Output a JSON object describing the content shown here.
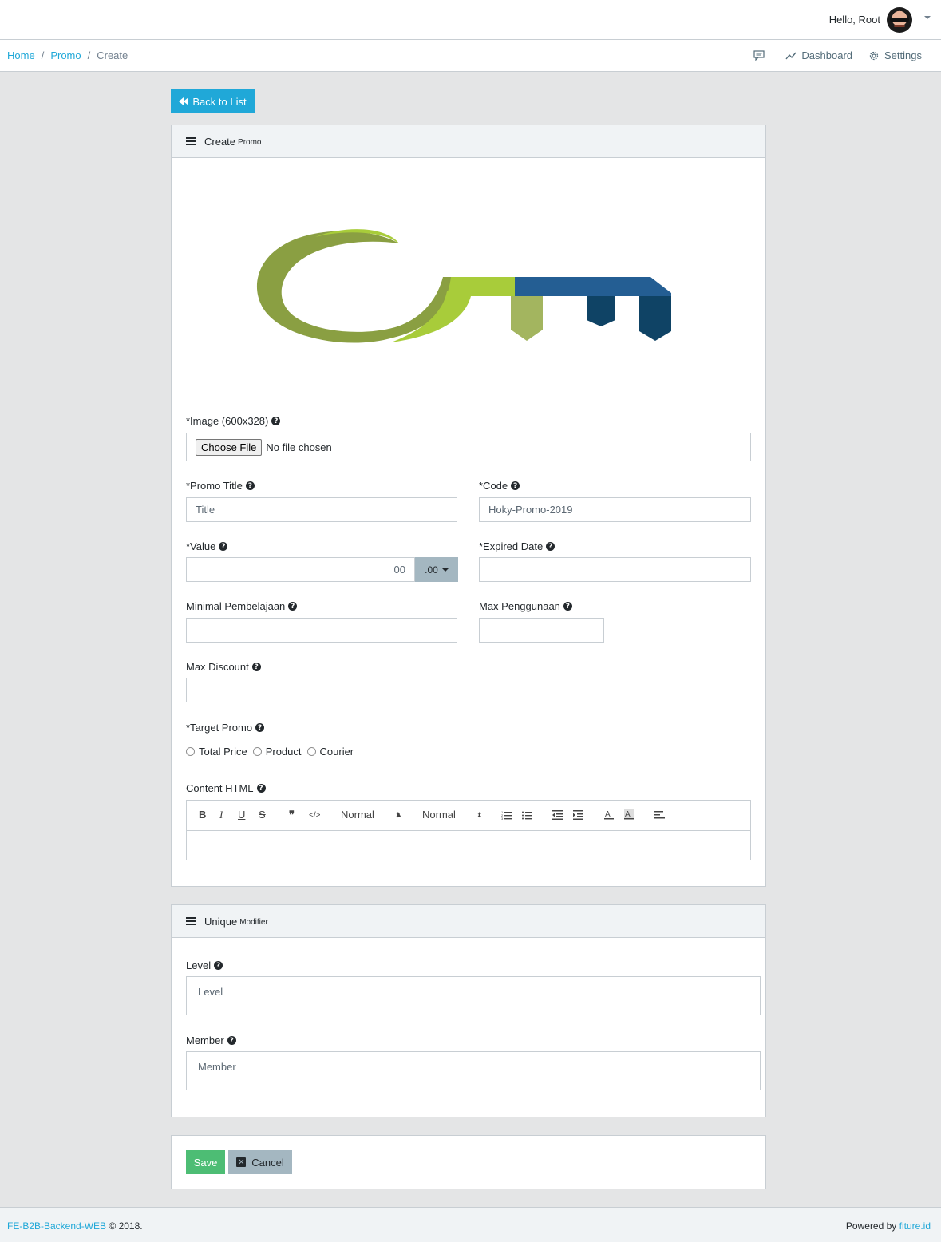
{
  "header": {
    "greeting": "Hello, Root"
  },
  "breadcrumb": {
    "items": [
      "Home",
      "Promo"
    ],
    "separator": "/",
    "active": "Create",
    "dashboard": "Dashboard",
    "settings": "Settings"
  },
  "back_button": "Back to List",
  "create_card": {
    "title": "Create",
    "subtitle": "Promo",
    "image_label": "*Image (600x328)",
    "choose_file": "Choose File",
    "no_file": "No file chosen",
    "promo_title_label": "*Promo Title",
    "promo_title_placeholder": "Title",
    "code_label": "*Code",
    "code_placeholder": "Hoky-Promo-2019",
    "value_label": "*Value",
    "value_placeholder": "00",
    "value_dropdown": ".00",
    "expired_label": "*Expired Date",
    "minimal_label": "Minimal Pembelajaan",
    "max_usage_label": "Max Penggunaan",
    "max_discount_label": "Max Discount",
    "target_label": "*Target Promo",
    "target_options": [
      "Total Price",
      "Product",
      "Courier"
    ],
    "content_label": "Content HTML",
    "editor": {
      "font_size": "Normal",
      "header": "Normal"
    }
  },
  "unique_card": {
    "title": "Unique",
    "subtitle": "Modifier",
    "level_label": "Level",
    "level_placeholder": "Level",
    "member_label": "Member",
    "member_placeholder": "Member"
  },
  "actions": {
    "save": "Save",
    "cancel": "Cancel"
  },
  "footer": {
    "app": "FE-B2B-Backend-WEB",
    "copyright": "© 2018.",
    "powered": "Powered by",
    "brand": "fiture.id"
  },
  "colors": {
    "primary": "#20a8d8",
    "success": "#4dbd74",
    "secondary": "#a4b7c1",
    "logo_green": "#a8cc3a",
    "logo_olive": "#8a9f42",
    "logo_blue": "#245e93",
    "logo_navy": "#0f4365"
  }
}
